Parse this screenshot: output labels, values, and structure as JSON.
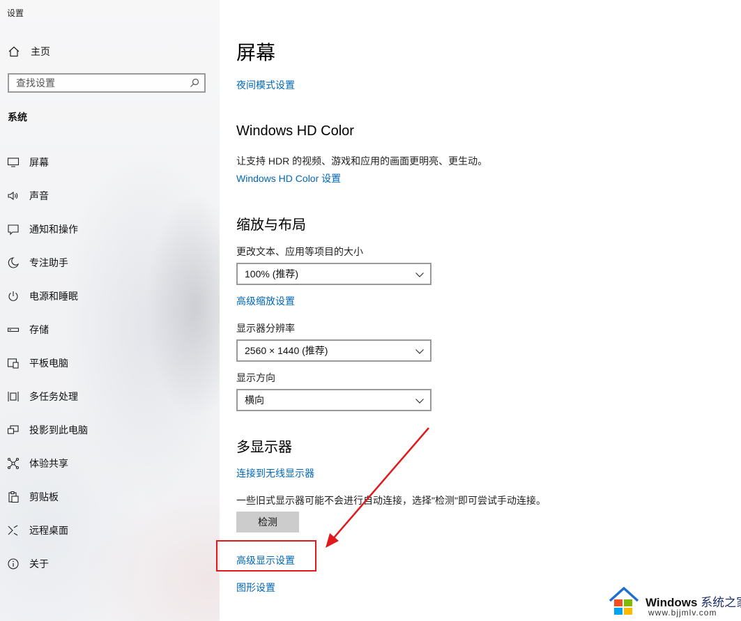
{
  "window": {
    "title": "设置"
  },
  "sidebar": {
    "home_label": "主页",
    "search_placeholder": "查找设置",
    "section_title": "系统",
    "items": [
      {
        "label": "屏幕",
        "icon": "monitor-icon"
      },
      {
        "label": "声音",
        "icon": "speaker-icon"
      },
      {
        "label": "通知和操作",
        "icon": "notification-icon"
      },
      {
        "label": "专注助手",
        "icon": "moon-icon"
      },
      {
        "label": "电源和睡眠",
        "icon": "power-icon"
      },
      {
        "label": "存储",
        "icon": "storage-icon"
      },
      {
        "label": "平板电脑",
        "icon": "tablet-icon"
      },
      {
        "label": "多任务处理",
        "icon": "multitask-icon"
      },
      {
        "label": "投影到此电脑",
        "icon": "project-icon"
      },
      {
        "label": "体验共享",
        "icon": "share-icon"
      },
      {
        "label": "剪贴板",
        "icon": "clipboard-icon"
      },
      {
        "label": "远程桌面",
        "icon": "remote-desktop-icon"
      },
      {
        "label": "关于",
        "icon": "info-icon"
      }
    ]
  },
  "main": {
    "page_title": "屏幕",
    "night_light_link": "夜间模式设置",
    "hd_color": {
      "heading": "Windows HD Color",
      "description": "让支持 HDR 的视频、游戏和应用的画面更明亮、更生动。",
      "link": "Windows HD Color 设置"
    },
    "scale_layout": {
      "heading": "缩放与布局",
      "scale_label": "更改文本、应用等项目的大小",
      "scale_value": "100% (推荐)",
      "advanced_scaling_link": "高级缩放设置",
      "resolution_label": "显示器分辨率",
      "resolution_value": "2560 × 1440 (推荐)",
      "orientation_label": "显示方向",
      "orientation_value": "横向"
    },
    "multi_display": {
      "heading": "多显示器",
      "wireless_link": "连接到无线显示器",
      "detect_note": "一些旧式显示器可能不会进行自动连接，选择\"检测\"即可尝试手动连接。",
      "detect_button": "检测",
      "advanced_display_link": "高级显示设置",
      "graphics_link": "图形设置"
    }
  },
  "annotation": {
    "color": "#e0191c"
  },
  "colors": {
    "link": "#0067b8",
    "button_bg": "#cccccc"
  },
  "watermark": {
    "brand": "Windows",
    "suffix": "系统之家",
    "url": "www.bjjmlv.com"
  }
}
